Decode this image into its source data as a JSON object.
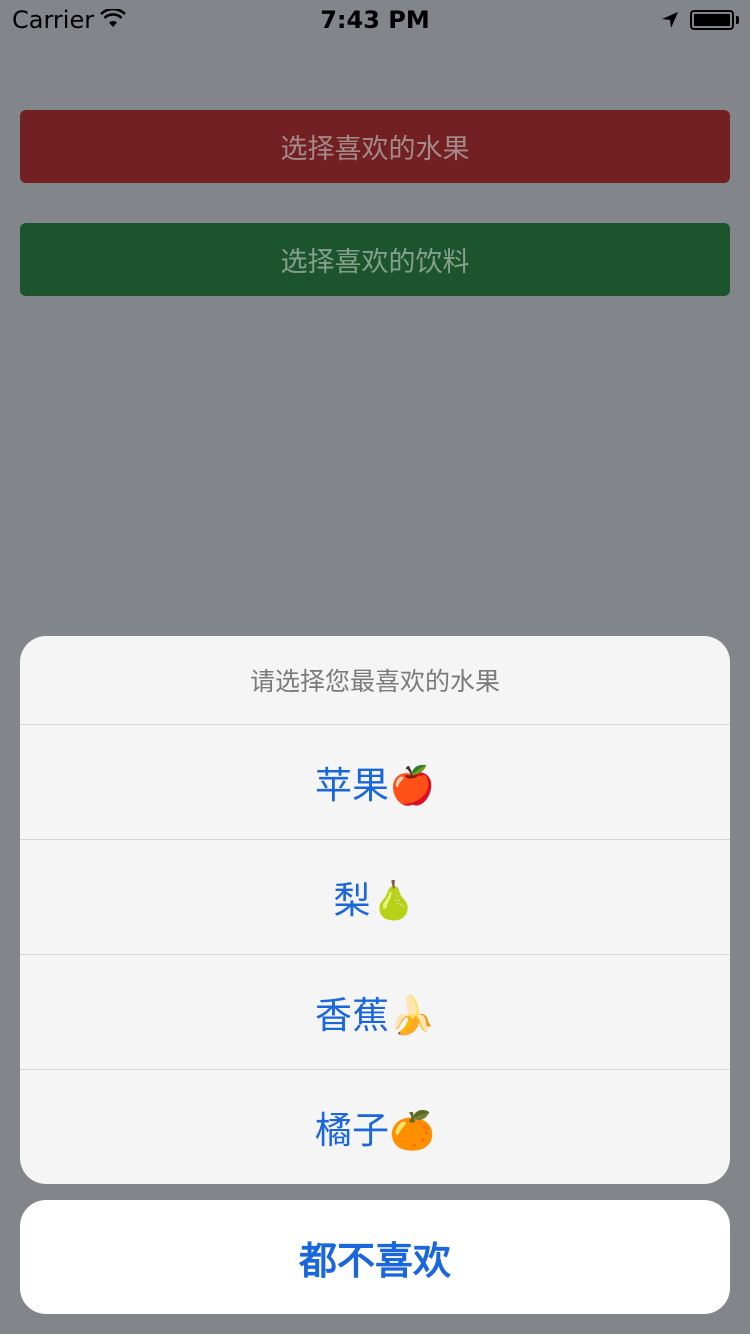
{
  "status_bar": {
    "carrier": "Carrier",
    "time": "7:43 PM"
  },
  "buttons": {
    "fruit_label": "选择喜欢的水果",
    "drink_label": "选择喜欢的饮料"
  },
  "action_sheet": {
    "title": "请选择您最喜欢的水果",
    "options": [
      {
        "label": "苹果🍎"
      },
      {
        "label": "梨🍐"
      },
      {
        "label": "香蕉🍌"
      },
      {
        "label": "橘子🍊"
      }
    ],
    "cancel_label": "都不喜欢"
  },
  "colors": {
    "overlay": "#82858a",
    "fruit_button": "#722022",
    "drink_button": "#1c542e",
    "action_text": "#1a66dd"
  }
}
